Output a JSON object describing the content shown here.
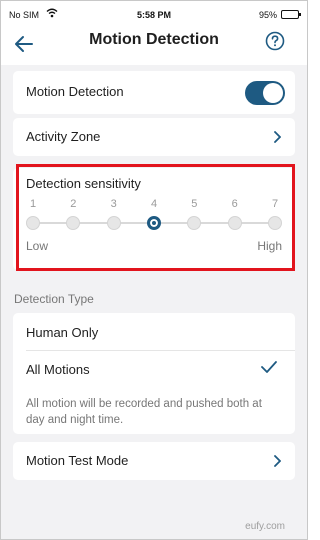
{
  "status_bar": {
    "carrier": "No SIM",
    "time": "5:58 PM",
    "battery_pct": "95%"
  },
  "nav": {
    "title": "Motion Detection"
  },
  "rows": {
    "motion_detection": {
      "label": "Motion Detection",
      "enabled": true
    },
    "activity_zone": {
      "label": "Activity Zone"
    }
  },
  "sensitivity": {
    "title": "Detection sensitivity",
    "levels": [
      "1",
      "2",
      "3",
      "4",
      "5",
      "6",
      "7"
    ],
    "selected": 4,
    "low_label": "Low",
    "high_label": "High"
  },
  "detection_type": {
    "section_title": "Detection Type",
    "options": [
      {
        "label": "Human Only",
        "selected": false
      },
      {
        "label": "All Motions",
        "selected": true
      }
    ],
    "description": "All motion will be recorded and pushed both at day and night time."
  },
  "test_mode": {
    "label": "Motion Test Mode"
  },
  "footer": {
    "brand": "eufy.com"
  },
  "colors": {
    "accent": "#1e5a82",
    "highlight_border": "#e2141d",
    "background": "#f2f2f4"
  }
}
